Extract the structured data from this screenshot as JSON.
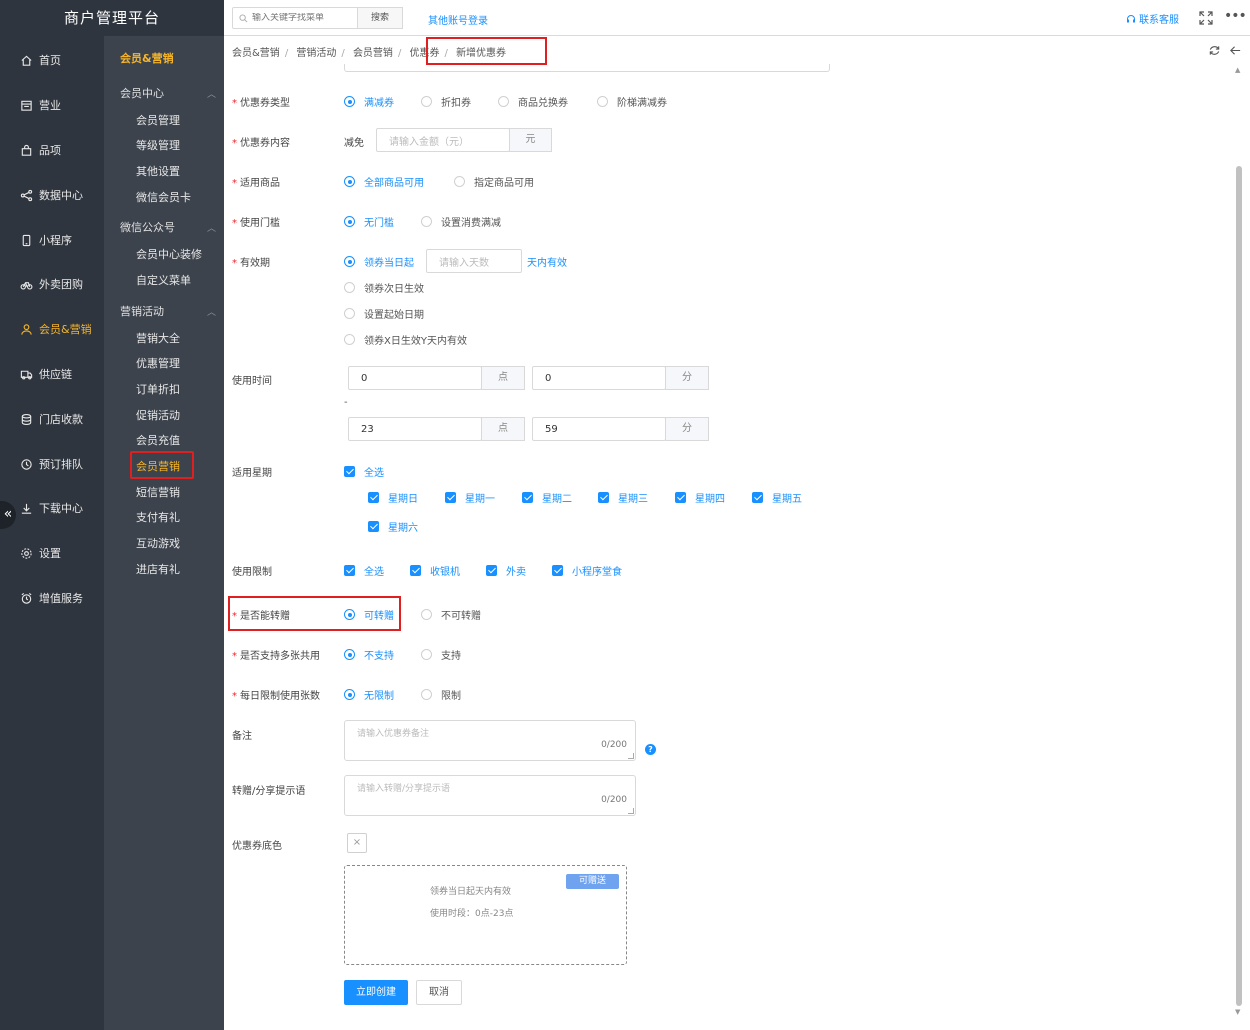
{
  "app": {
    "title": "商户管理平台"
  },
  "topbar": {
    "search_placeholder": "输入关键字找菜单",
    "search_button": "搜索",
    "other_login": "其他账号登录",
    "contact": "联系客服"
  },
  "nav": [
    {
      "label": "首页",
      "icon": "home-icon"
    },
    {
      "label": "营业",
      "icon": "business-icon"
    },
    {
      "label": "品项",
      "icon": "bag-icon"
    },
    {
      "label": "数据中心",
      "icon": "share-icon"
    },
    {
      "label": "小程序",
      "icon": "phone-icon"
    },
    {
      "label": "外卖团购",
      "icon": "bike-icon"
    },
    {
      "label": "会员&营销",
      "icon": "user-icon"
    },
    {
      "label": "供应链",
      "icon": "truck-icon"
    },
    {
      "label": "门店收款",
      "icon": "database-icon"
    },
    {
      "label": "预订排队",
      "icon": "clock-icon"
    },
    {
      "label": "下载中心",
      "icon": "download-icon"
    },
    {
      "label": "设置",
      "icon": "gear-icon"
    },
    {
      "label": "增值服务",
      "icon": "alarm-icon"
    }
  ],
  "subnav": {
    "title": "会员&营销",
    "groups": [
      {
        "label": "会员中心",
        "items": [
          "会员管理",
          "等级管理",
          "其他设置",
          "微信会员卡"
        ]
      },
      {
        "label": "微信公众号",
        "items": [
          "会员中心装修",
          "自定义菜单"
        ]
      },
      {
        "label": "营销活动",
        "items": [
          "营销大全",
          "优惠管理",
          "订单折扣",
          "促销活动",
          "会员充值",
          "会员营销",
          "短信营销",
          "支付有礼",
          "互动游戏",
          "进店有礼"
        ]
      }
    ]
  },
  "breadcrumb": [
    "会员&营销",
    "营销活动",
    "会员营销",
    "优惠券",
    "新增优惠券"
  ],
  "form": {
    "coupon_type": {
      "label": "优惠券类型",
      "options": [
        "满减券",
        "折扣券",
        "商品兑换券",
        "阶梯满减券"
      ]
    },
    "coupon_content": {
      "label": "优惠券内容",
      "prefix": "减免",
      "placeholder": "请输入金额（元）",
      "suffix": "元"
    },
    "applicable_goods": {
      "label": "适用商品",
      "options": [
        "全部商品可用",
        "指定商品可用"
      ]
    },
    "threshold": {
      "label": "使用门槛",
      "options": [
        "无门槛",
        "设置消费满减"
      ]
    },
    "validity": {
      "label": "有效期",
      "options": [
        "领券当日起",
        "领券次日生效",
        "设置起始日期",
        "领券X日生效Y天内有效"
      ],
      "days_placeholder": "请输入天数",
      "days_suffix": "天内有效"
    },
    "use_time": {
      "label": "使用时间",
      "start_hour": "0",
      "start_min": "0",
      "end_hour": "23",
      "end_min": "59",
      "hour_unit": "点",
      "min_unit": "分",
      "separator": "-"
    },
    "weekdays": {
      "label": "适用星期",
      "all": "全选",
      "days": [
        "星期日",
        "星期一",
        "星期二",
        "星期三",
        "星期四",
        "星期五",
        "星期六"
      ]
    },
    "use_limit": {
      "label": "使用限制",
      "options": [
        "全选",
        "收银机",
        "外卖",
        "小程序堂食"
      ]
    },
    "transferable": {
      "label": "是否能转赠",
      "options": [
        "可转赠",
        "不可转赠"
      ]
    },
    "multi_use": {
      "label": "是否支持多张共用",
      "options": [
        "不支持",
        "支持"
      ]
    },
    "daily_limit": {
      "label": "每日限制使用张数",
      "options": [
        "无限制",
        "限制"
      ]
    },
    "remark": {
      "label": "备注",
      "placeholder": "请输入优惠券备注",
      "count": "0/200"
    },
    "share_tip": {
      "label": "转赠/分享提示语",
      "placeholder": "请输入转赠/分享提示语",
      "count": "0/200"
    },
    "bg_color": {
      "label": "优惠券底色",
      "swatch": "×"
    },
    "preview": {
      "badge": "可赠送",
      "line1": "领券当日起天内有效",
      "line2": "使用时段：0点-23点"
    },
    "submit": "立即创建",
    "cancel": "取消"
  },
  "colors": {
    "accent": "#1890ff",
    "active_nav": "#f5b52b",
    "highlight_box": "#e02020",
    "sidebar_bg": "#2f353e"
  }
}
